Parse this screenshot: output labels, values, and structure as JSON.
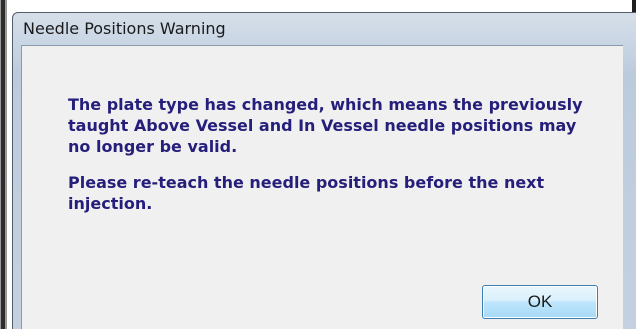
{
  "dialog": {
    "title": "Needle Positions Warning",
    "message_paragraph_1": "The plate type has changed, which means the previously taught Above Vessel and In Vessel needle positions may no longer be valid.",
    "message_paragraph_2": "Please re-teach the needle positions before the next injection.",
    "ok_label": "OK"
  },
  "colors": {
    "message_text": "#251e7a",
    "title_bar": "#c9d6e4",
    "client_area": "#f0f0f0",
    "button_border": "#3c7fb1"
  }
}
